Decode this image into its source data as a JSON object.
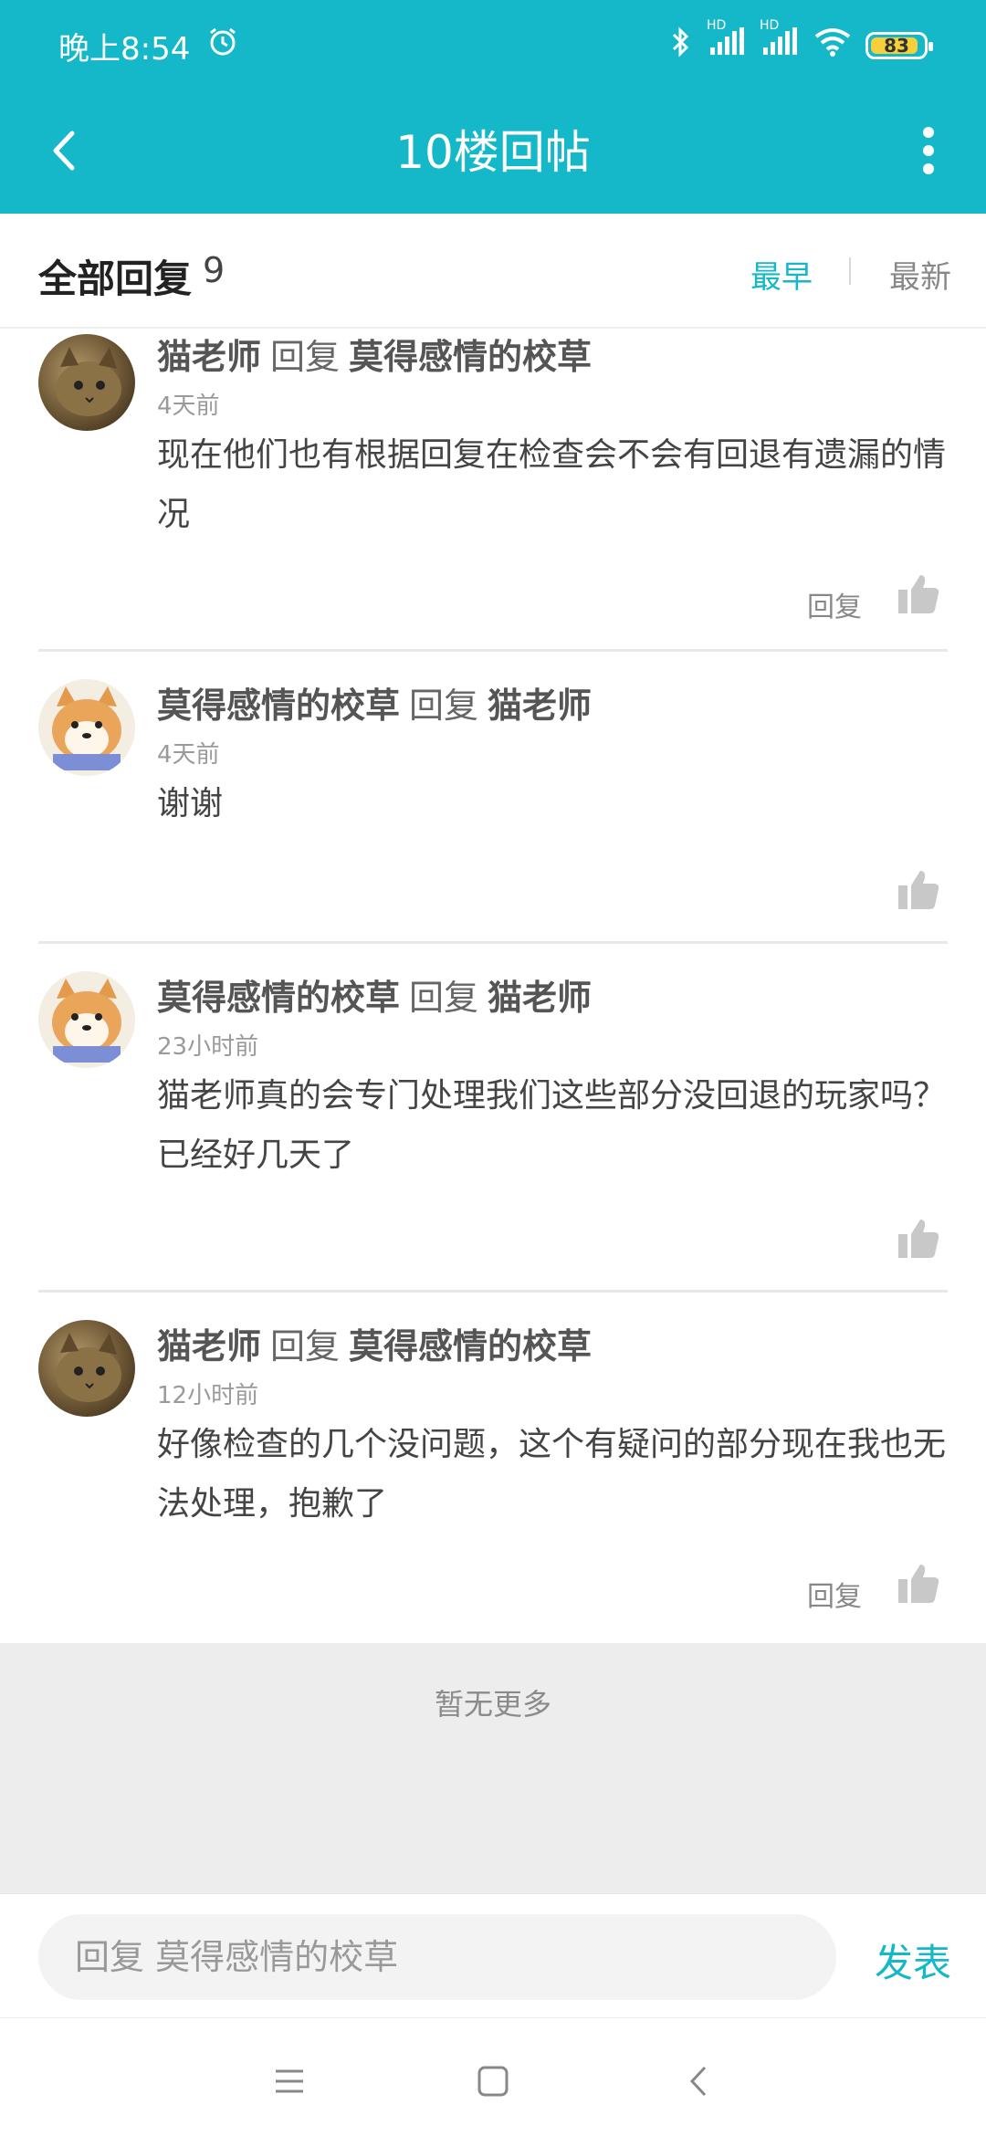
{
  "status_bar": {
    "time": "晚上8:54",
    "battery": "83",
    "signal_label_1": "HD",
    "signal_label_2": "HD"
  },
  "nav": {
    "title": "10楼回帖"
  },
  "filter": {
    "title": "全部回复",
    "count": "9",
    "sort_earliest": "最早",
    "sort_newest": "最新"
  },
  "replies": [
    {
      "author": "猫老师",
      "verb": "回复",
      "target": "莫得感情的校草",
      "time": "4天前",
      "text": "现在他们也有根据回复在检查会不会有回退有遗漏的情况",
      "action": "回复"
    },
    {
      "author": "莫得感情的校草",
      "verb": "回复",
      "target": "猫老师",
      "time": "4天前",
      "text": "谢谢",
      "action": ""
    },
    {
      "author": "莫得感情的校草",
      "verb": "回复",
      "target": "猫老师",
      "time": "23小时前",
      "text": "猫老师真的会专门处理我们这些部分没回退的玩家吗？已经好几天了",
      "action": ""
    },
    {
      "author": "猫老师",
      "verb": "回复",
      "target": "莫得感情的校草",
      "time": "12小时前",
      "text": "好像检查的几个没问题，这个有疑问的部分现在我也无法处理，抱歉了",
      "action": "回复"
    }
  ],
  "no_more": "暂无更多",
  "compose": {
    "placeholder": "回复 莫得感情的校草",
    "send": "发表"
  },
  "colors": {
    "accent": "#14b8c8",
    "header_bg": "#14b8c8",
    "footer_bg": "#ededed"
  }
}
